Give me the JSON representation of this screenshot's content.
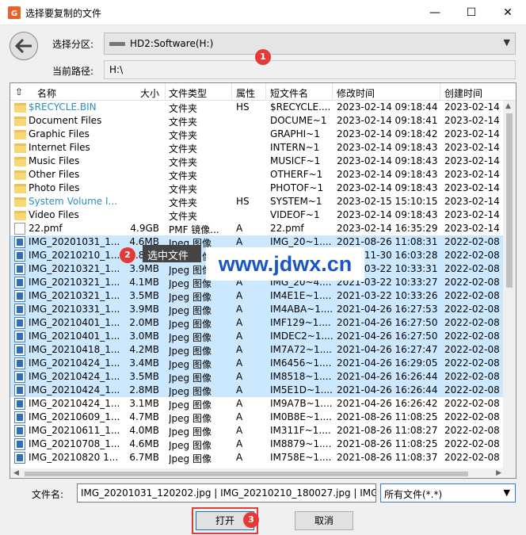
{
  "window": {
    "title": "选择要复制的文件",
    "minimize": "—",
    "maximize": "☐",
    "close": "✕"
  },
  "drive": {
    "label": "选择分区:",
    "value": "HD2:Software(H:)"
  },
  "path": {
    "label": "当前路径:",
    "value": "H:\\"
  },
  "columns": {
    "name": "名称",
    "size": "大小",
    "type": "文件类型",
    "attr": "属性",
    "short": "短文件名",
    "modified": "修改时间",
    "created": "创建时间"
  },
  "rows": [
    {
      "icon": "folder",
      "name": "$RECYCLE.BIN",
      "size": "",
      "type": "文件夹",
      "attr": "HS",
      "short": "$RECYCLE....",
      "mod": "2023-02-14 09:18:44",
      "cre": "2023-02-14 0",
      "teal": true,
      "sel": false
    },
    {
      "icon": "folder",
      "name": "Document Files",
      "size": "",
      "type": "文件夹",
      "attr": "",
      "short": "DOCUME~1",
      "mod": "2023-02-14 09:18:41",
      "cre": "2023-02-14 0",
      "teal": false,
      "sel": false
    },
    {
      "icon": "folder",
      "name": "Graphic Files",
      "size": "",
      "type": "文件夹",
      "attr": "",
      "short": "GRAPHI~1",
      "mod": "2023-02-14 09:18:42",
      "cre": "2023-02-14 0",
      "teal": false,
      "sel": false
    },
    {
      "icon": "folder",
      "name": "Internet Files",
      "size": "",
      "type": "文件夹",
      "attr": "",
      "short": "INTERN~1",
      "mod": "2023-02-14 09:18:43",
      "cre": "2023-02-14 0",
      "teal": false,
      "sel": false
    },
    {
      "icon": "folder",
      "name": "Music Files",
      "size": "",
      "type": "文件夹",
      "attr": "",
      "short": "MUSICF~1",
      "mod": "2023-02-14 09:18:43",
      "cre": "2023-02-14 0",
      "teal": false,
      "sel": false
    },
    {
      "icon": "folder",
      "name": "Other Files",
      "size": "",
      "type": "文件夹",
      "attr": "",
      "short": "OTHERF~1",
      "mod": "2023-02-14 09:18:43",
      "cre": "2023-02-14 0",
      "teal": false,
      "sel": false
    },
    {
      "icon": "folder",
      "name": "Photo Files",
      "size": "",
      "type": "文件夹",
      "attr": "",
      "short": "PHOTOF~1",
      "mod": "2023-02-14 09:18:43",
      "cre": "2023-02-14 0",
      "teal": false,
      "sel": false
    },
    {
      "icon": "folder",
      "name": "System Volume I...",
      "size": "",
      "type": "文件夹",
      "attr": "HS",
      "short": "SYSTEM~1",
      "mod": "2023-02-15 15:10:15",
      "cre": "2023-02-14 0",
      "teal": true,
      "sel": false
    },
    {
      "icon": "folder",
      "name": "Video Files",
      "size": "",
      "type": "文件夹",
      "attr": "",
      "short": "VIDEOF~1",
      "mod": "2023-02-14 09:18:43",
      "cre": "2023-02-14 0",
      "teal": false,
      "sel": false
    },
    {
      "icon": "doc",
      "name": "22.pmf",
      "size": "4.9GB",
      "type": "PMF 镜像...",
      "attr": "A",
      "short": "22.pmf",
      "mod": "2023-02-14 16:35:29",
      "cre": "2023-02-14 0",
      "teal": false,
      "sel": false
    },
    {
      "icon": "img",
      "name": "IMG_20201031_1...",
      "size": "4.6MB",
      "type": "Jpeg 图像",
      "attr": "A",
      "short": "IMG_20~1....",
      "mod": "2021-08-26 11:08:31",
      "cre": "2022-02-08 1",
      "teal": false,
      "sel": true
    },
    {
      "icon": "img",
      "name": "IMG_20210210_1...",
      "size": "2.8MB",
      "type": "Jpeg 图像",
      "attr": "A",
      "short": "IMG_20~2....",
      "mod": "2021-11-30 16:03:28",
      "cre": "2022-02-08 1",
      "teal": false,
      "sel": true
    },
    {
      "icon": "img",
      "name": "IMG_20210321_1...",
      "size": "3.9MB",
      "type": "Jpeg 图像",
      "attr": "A",
      "short": "IMG_20~3....",
      "mod": "2021-03-22 10:33:31",
      "cre": "2022-02-08 1",
      "teal": false,
      "sel": true
    },
    {
      "icon": "img",
      "name": "IMG_20210321_1...",
      "size": "4.1MB",
      "type": "Jpeg 图像",
      "attr": "A",
      "short": "IMG_20~4....",
      "mod": "2021-03-22 10:33:27",
      "cre": "2022-02-08 1",
      "teal": false,
      "sel": true
    },
    {
      "icon": "img",
      "name": "IMG_20210321_1...",
      "size": "3.5MB",
      "type": "Jpeg 图像",
      "attr": "A",
      "short": "IM4E1E~1....",
      "mod": "2021-03-22 10:33:26",
      "cre": "2022-02-08 1",
      "teal": false,
      "sel": true
    },
    {
      "icon": "img",
      "name": "IMG_20210331_1...",
      "size": "3.9MB",
      "type": "Jpeg 图像",
      "attr": "A",
      "short": "IM4ABA~1....",
      "mod": "2021-04-26 16:27:53",
      "cre": "2022-02-08 1",
      "teal": false,
      "sel": true
    },
    {
      "icon": "img",
      "name": "IMG_20210401_1...",
      "size": "2.0MB",
      "type": "Jpeg 图像",
      "attr": "A",
      "short": "IMF129~1....",
      "mod": "2021-04-26 16:27:50",
      "cre": "2022-02-08 1",
      "teal": false,
      "sel": true
    },
    {
      "icon": "img",
      "name": "IMG_20210401_1...",
      "size": "3.0MB",
      "type": "Jpeg 图像",
      "attr": "A",
      "short": "IMDEC2~1....",
      "mod": "2021-04-26 16:27:50",
      "cre": "2022-02-08 1",
      "teal": false,
      "sel": true
    },
    {
      "icon": "img",
      "name": "IMG_20210418_1...",
      "size": "4.2MB",
      "type": "Jpeg 图像",
      "attr": "A",
      "short": "IM7A72~1....",
      "mod": "2021-04-26 16:27:47",
      "cre": "2022-02-08 1",
      "teal": false,
      "sel": true
    },
    {
      "icon": "img",
      "name": "IMG_20210424_1...",
      "size": "3.4MB",
      "type": "Jpeg 图像",
      "attr": "A",
      "short": "IM6456~1....",
      "mod": "2021-04-26 16:29:05",
      "cre": "2022-02-08 1",
      "teal": false,
      "sel": true
    },
    {
      "icon": "img",
      "name": "IMG_20210424_1...",
      "size": "3.5MB",
      "type": "Jpeg 图像",
      "attr": "A",
      "short": "IM8518~1....",
      "mod": "2021-04-26 16:26:44",
      "cre": "2022-02-08 1",
      "teal": false,
      "sel": true
    },
    {
      "icon": "img",
      "name": "IMG_20210424_1...",
      "size": "2.8MB",
      "type": "Jpeg 图像",
      "attr": "A",
      "short": "IM5E1D~1....",
      "mod": "2021-04-26 16:26:44",
      "cre": "2022-02-08 1",
      "teal": false,
      "sel": true
    },
    {
      "icon": "img",
      "name": "IMG_20210424_1...",
      "size": "3.1MB",
      "type": "Jpeg 图像",
      "attr": "A",
      "short": "IM9A7B~1....",
      "mod": "2021-04-26 16:26:42",
      "cre": "2022-02-08 1",
      "teal": false,
      "sel": false
    },
    {
      "icon": "img",
      "name": "IMG_20210609_1...",
      "size": "4.7MB",
      "type": "Jpeg 图像",
      "attr": "A",
      "short": "IM0B8E~1....",
      "mod": "2021-08-26 11:08:25",
      "cre": "2022-02-08 1",
      "teal": false,
      "sel": false
    },
    {
      "icon": "img",
      "name": "IMG_20210611_1...",
      "size": "4.0MB",
      "type": "Jpeg 图像",
      "attr": "A",
      "short": "IM311F~1....",
      "mod": "2021-08-26 11:08:27",
      "cre": "2022-02-08 1",
      "teal": false,
      "sel": false
    },
    {
      "icon": "img",
      "name": "IMG_20210708_1...",
      "size": "4.6MB",
      "type": "Jpeg 图像",
      "attr": "A",
      "short": "IM8879~1....",
      "mod": "2021-08-26 11:08:25",
      "cre": "2022-02-08 1",
      "teal": false,
      "sel": false
    },
    {
      "icon": "img",
      "name": "IMG_20210820 1...",
      "size": "6.7MB",
      "type": "Jpeg 图像",
      "attr": "A",
      "short": "IM758E~1....",
      "mod": "2021-08-26 11:08:37",
      "cre": "2022-02-08 1",
      "teal": false,
      "sel": false
    }
  ],
  "tooltip": "选中文件",
  "watermark": "www.jdwx.cn",
  "badges": {
    "b1": "1",
    "b2": "2",
    "b3": "3"
  },
  "filename": {
    "label": "文件名:",
    "value": "IMG_20201031_120202.jpg | IMG_20210210_180027.jpg | IMG_2"
  },
  "filetype": {
    "value": "所有文件(*.*)"
  },
  "buttons": {
    "open": "打开",
    "cancel": "取消"
  },
  "colors": {
    "selection": "#cce8ff",
    "badge": "#e53935",
    "system_folder_text": "#2a8fb8",
    "watermark": "#1a56c8"
  }
}
